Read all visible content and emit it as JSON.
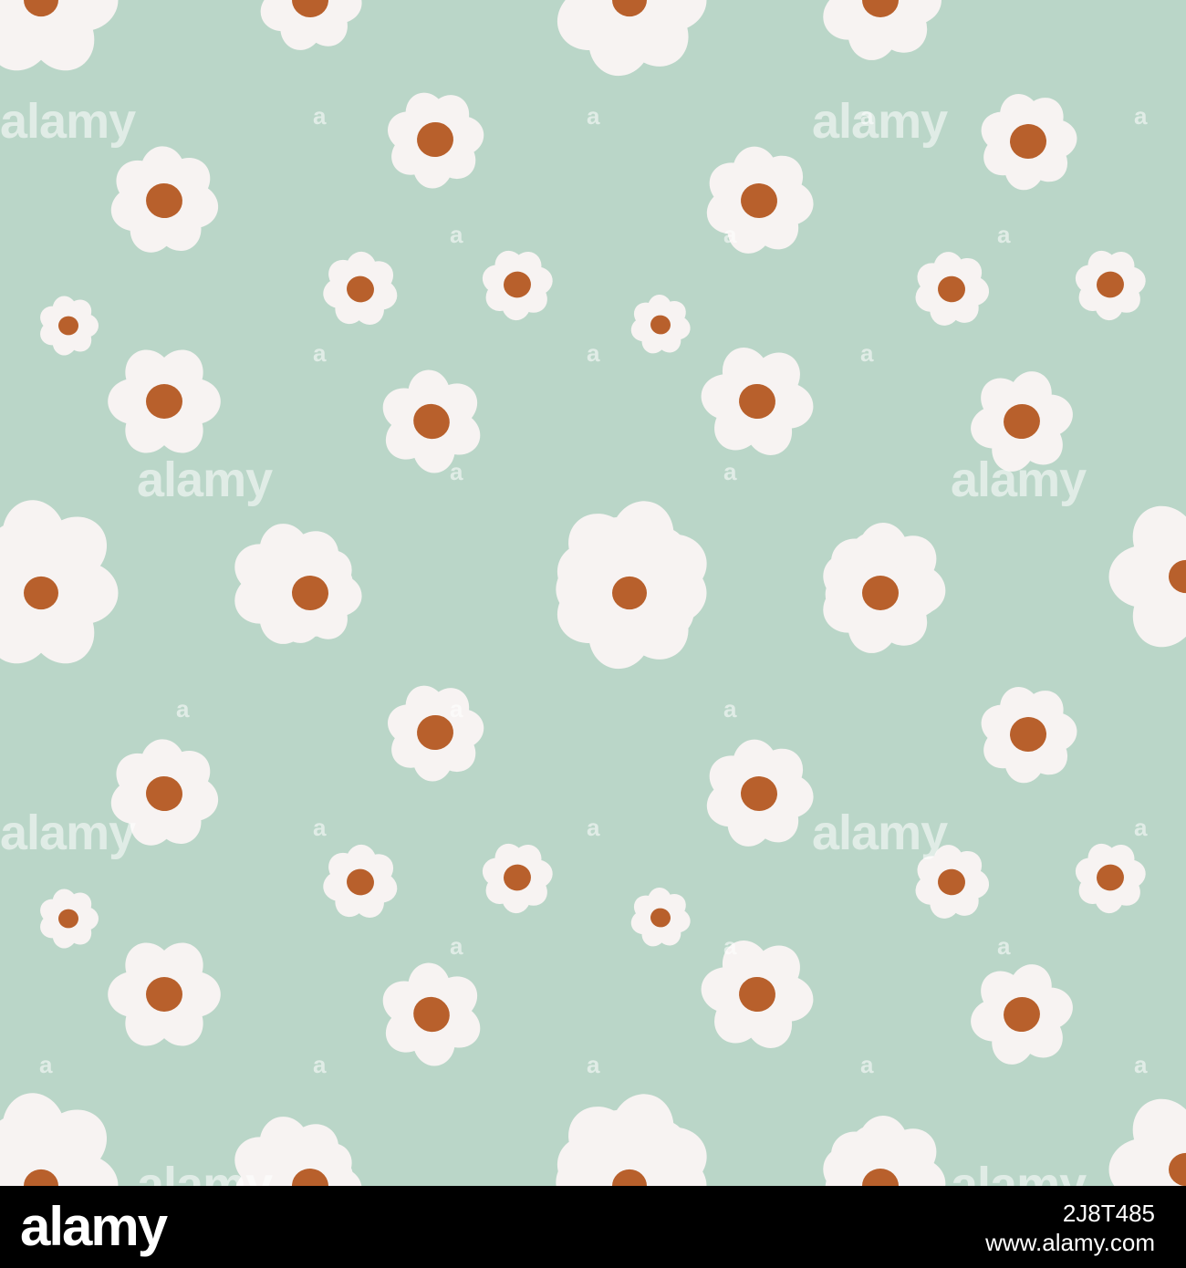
{
  "image": {
    "subject": "daisy-pattern",
    "colors": {
      "background": "#bad6c8",
      "petal": "#f7f3f2",
      "center": "#b8602c",
      "footer": "#000000"
    }
  },
  "watermark": {
    "text": "alamy",
    "short": "a"
  },
  "footer": {
    "logo": "alamy",
    "image_id": "2J8T485",
    "url": "www.alamy.com"
  }
}
